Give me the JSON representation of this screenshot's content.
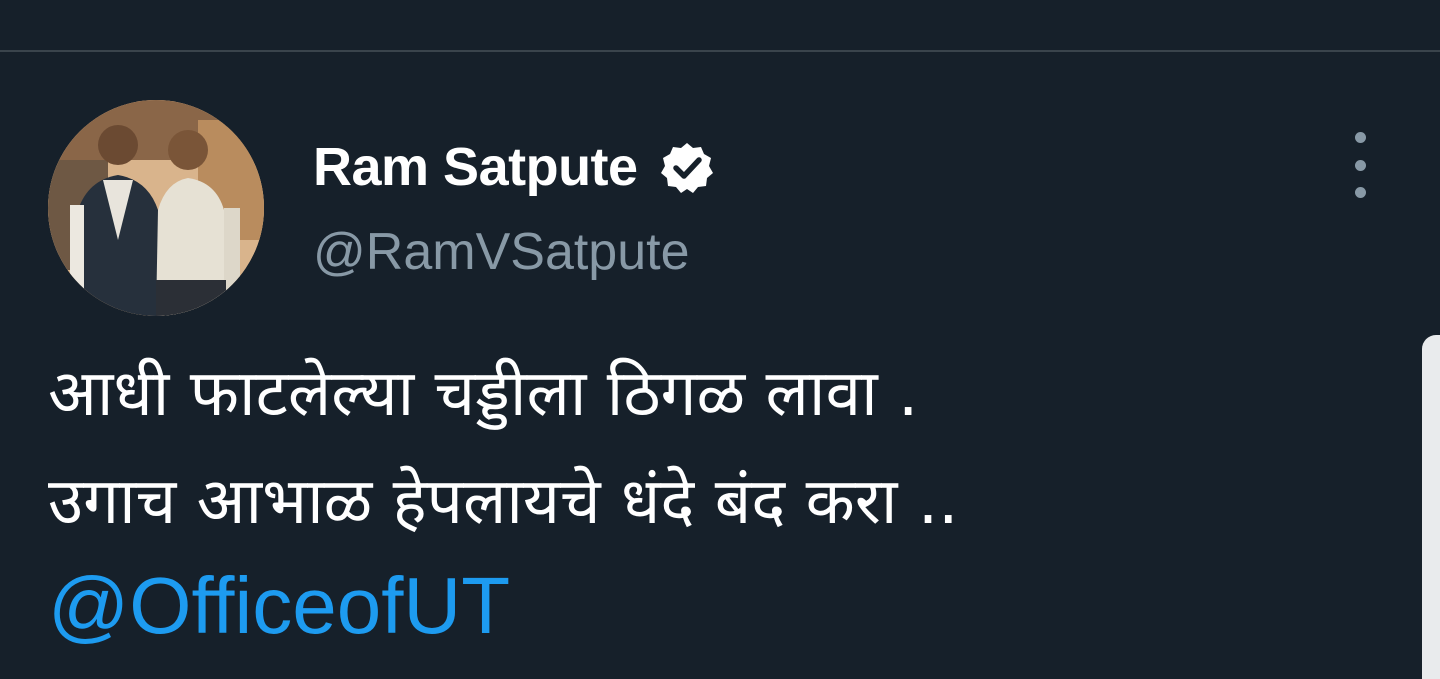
{
  "tweet": {
    "author": {
      "display_name": "Ram Satpute",
      "handle": "@RamVSatpute",
      "verified": true,
      "avatar_icon": "profile-photo"
    },
    "menu_icon": "more-vertical-icon",
    "text_lines": [
      "आधी फाटलेल्या चड्डीला ठिगळ लावा .",
      "उगाच आभाळ हेपलायचे धंदे बंद करा .."
    ],
    "mention": "@OfficeofUT"
  },
  "colors": {
    "background": "#16202a",
    "mention": "#1d9bf0",
    "secondary_text": "#8899a6"
  }
}
